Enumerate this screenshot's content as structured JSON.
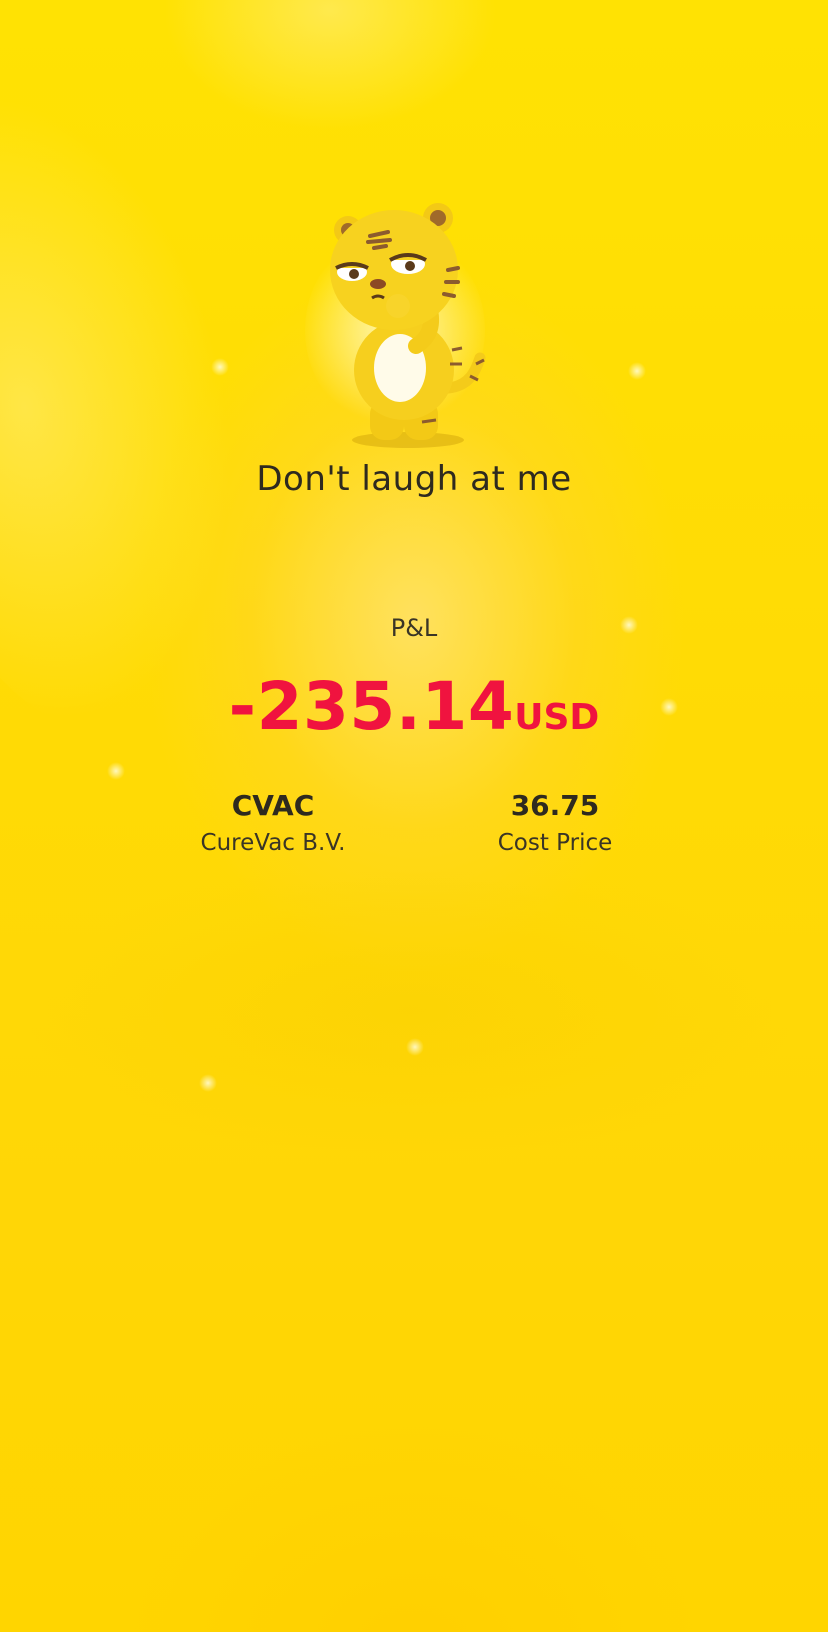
{
  "result": {
    "mascot": "tiger-mascot-icon",
    "title": "Don't laugh at me"
  },
  "pnl": {
    "label": "P&L",
    "value": "-235.14",
    "currency": "USD",
    "color": "#f0133f"
  },
  "stock": {
    "symbol": "CVAC",
    "name": "CureVac B.V."
  },
  "cost": {
    "value": "36.75",
    "label": "Cost Price"
  },
  "colors": {
    "background": "#ffdb05",
    "text": "#2e2a1f",
    "negative": "#f0133f"
  }
}
